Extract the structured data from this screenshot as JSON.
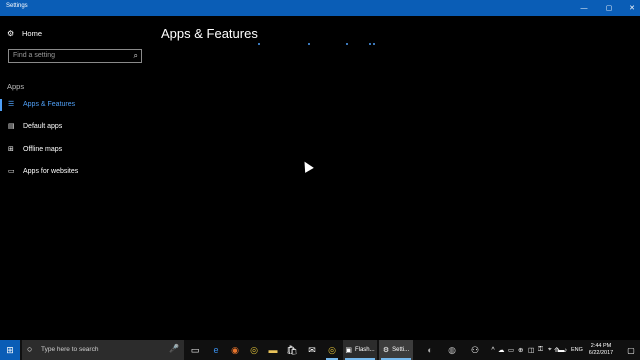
{
  "window": {
    "title": "Settings",
    "controls": {
      "minimize": "—",
      "maximize": "▢",
      "close": "✕"
    },
    "accent": "#0a5db6"
  },
  "sidebar": {
    "home": {
      "label": "Home",
      "icon": "gear-icon",
      "glyph": "⚙"
    },
    "search": {
      "placeholder": "Find a setting",
      "icon": "search-icon",
      "glyph": "⌕"
    },
    "section_label": "Apps",
    "items": [
      {
        "label": "Apps & Features",
        "icon": "list-icon",
        "glyph": "☰",
        "active": true
      },
      {
        "label": "Default apps",
        "icon": "default-apps-icon",
        "glyph": "▤",
        "active": false
      },
      {
        "label": "Offline maps",
        "icon": "map-icon",
        "glyph": "⊞",
        "active": false
      },
      {
        "label": "Apps for websites",
        "icon": "websites-icon",
        "glyph": "▭",
        "active": false
      }
    ],
    "active_color": "#4f9ff6"
  },
  "main": {
    "title": "Apps & Features",
    "loading": true
  },
  "taskbar": {
    "start_glyph": "⊞",
    "search_placeholder": "Type here to search",
    "search_glyph": "○",
    "mic_glyph": "🎤",
    "apps": [
      {
        "name": "task-view-icon",
        "glyph": "▭"
      },
      {
        "name": "edge-icon",
        "glyph": "e"
      },
      {
        "name": "firefox-icon",
        "glyph": "◉"
      },
      {
        "name": "chrome-icon",
        "glyph": "◎"
      },
      {
        "name": "file-explorer-icon",
        "glyph": "▬"
      },
      {
        "name": "store-icon",
        "glyph": "🛍"
      },
      {
        "name": "mail-icon",
        "glyph": "✉"
      },
      {
        "name": "chrome-icon-2",
        "glyph": "◎"
      }
    ],
    "tasks": [
      {
        "label": "Flash...",
        "glyph": "▣",
        "active": false
      },
      {
        "label": "Setti...",
        "glyph": "⚙",
        "active": true
      }
    ],
    "tray": {
      "user_glyph": "◐",
      "globe_glyph": "◍",
      "people_glyph": "⚇",
      "chevron_glyph": "^",
      "icons": [
        "☁",
        "▭",
        "⊕",
        "◫",
        "⚿",
        "⌖",
        "▬",
        "⟰",
        "♪"
      ],
      "language": "ENG",
      "time": "2:44 PM",
      "date": "6/22/2017",
      "notification_glyph": "▢"
    }
  }
}
